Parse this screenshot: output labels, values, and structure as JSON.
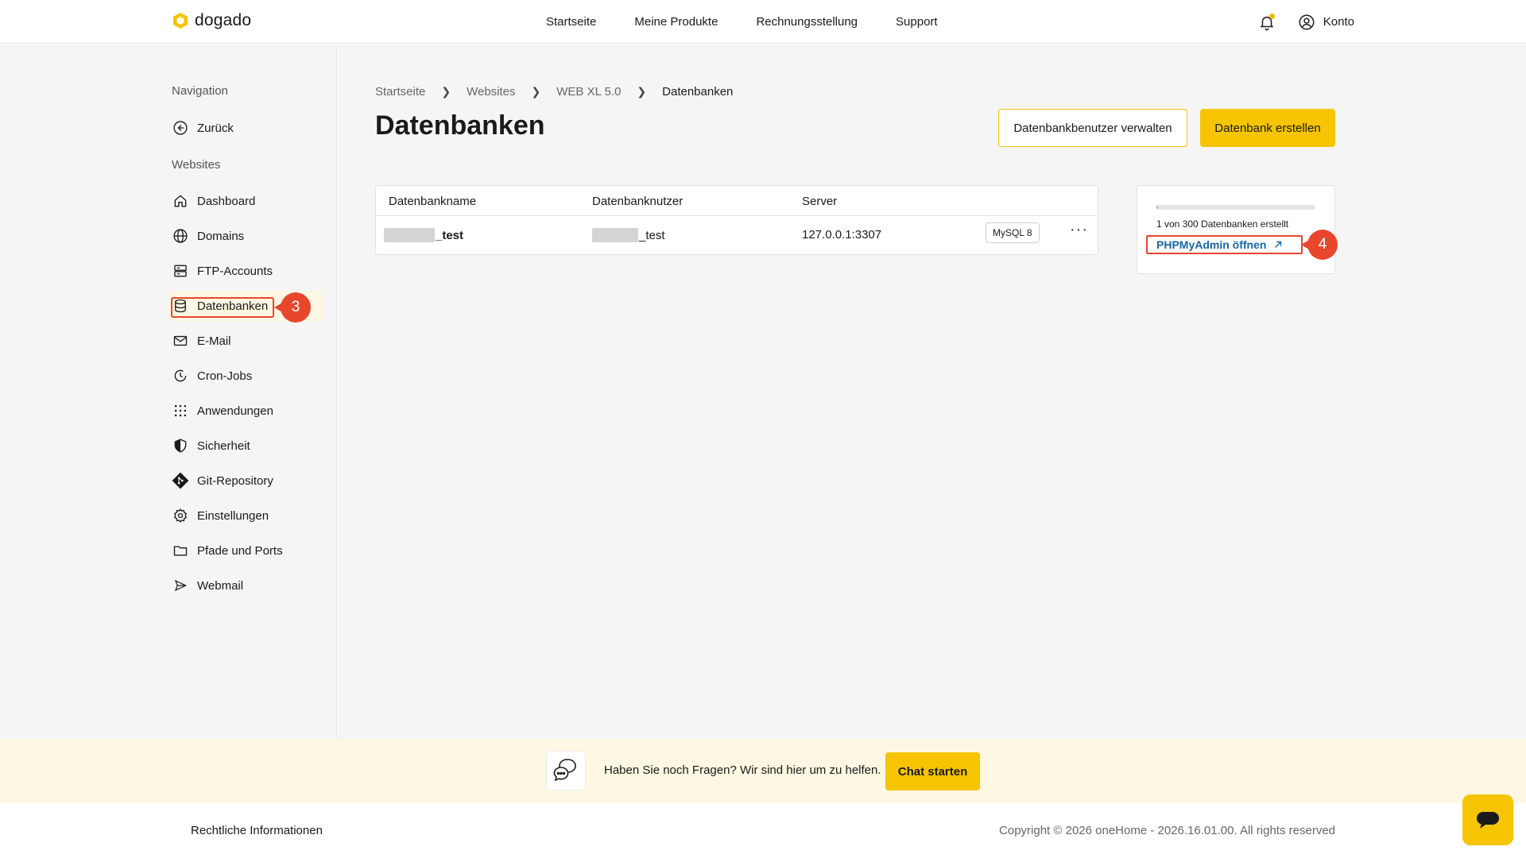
{
  "brand": {
    "name": "dogado",
    "accent": "#f6c400",
    "highlight": "#e8472e",
    "link": "#1668a8"
  },
  "topnav": [
    "Startseite",
    "Meine Produkte",
    "Rechnungsstellung",
    "Support"
  ],
  "header": {
    "account_label": "Konto",
    "bell_icon": "bell-icon",
    "user_icon": "user-circle-icon"
  },
  "sidebar": {
    "nav_heading": "Navigation",
    "back_label": "Zurück",
    "section_heading": "Websites",
    "items": [
      {
        "label": "Dashboard",
        "icon": "home-icon"
      },
      {
        "label": "Domains",
        "icon": "globe-icon"
      },
      {
        "label": "FTP-Accounts",
        "icon": "server-icon"
      },
      {
        "label": "Datenbanken",
        "icon": "database-icon"
      },
      {
        "label": "E-Mail",
        "icon": "mail-icon"
      },
      {
        "label": "Cron-Jobs",
        "icon": "clock-icon"
      },
      {
        "label": "Anwendungen",
        "icon": "grid-icon"
      },
      {
        "label": "Sicherheit",
        "icon": "shield-icon"
      },
      {
        "label": "Git-Repository",
        "icon": "git-icon"
      },
      {
        "label": "Einstellungen",
        "icon": "gear-icon"
      },
      {
        "label": "Pfade und Ports",
        "icon": "folder-icon"
      },
      {
        "label": "Webmail",
        "icon": "send-icon"
      }
    ],
    "step_badge": "3"
  },
  "breadcrumb": [
    "Startseite",
    "Websites",
    "WEB XL 5.0",
    "Datenbanken"
  ],
  "page": {
    "title": "Datenbanken",
    "manage_users_button": "Datenbankbenutzer verwalten",
    "create_button": "Datenbank erstellen"
  },
  "table": {
    "columns": [
      "Datenbankname",
      "Datenbanknutzer",
      "Server"
    ],
    "rows": [
      {
        "name_suffix": "_test",
        "user_suffix": "_test",
        "server": "127.0.0.1:3307",
        "badge": "MySQL 8",
        "more": "···"
      }
    ]
  },
  "usage_card": {
    "progress_fraction": 0.0033,
    "text": "1 von 300 Datenbanken erstellt",
    "link_label": "PHPMyAdmin öffnen",
    "step_badge": "4"
  },
  "helpbar": {
    "text": "Haben Sie noch Fragen? Wir sind hier um zu helfen.",
    "button": "Chat starten"
  },
  "footer": {
    "legal": "Rechtliche Informationen",
    "copyright": "Copyright © 2026 oneHome - 2026.16.01.00. All rights reserved"
  }
}
